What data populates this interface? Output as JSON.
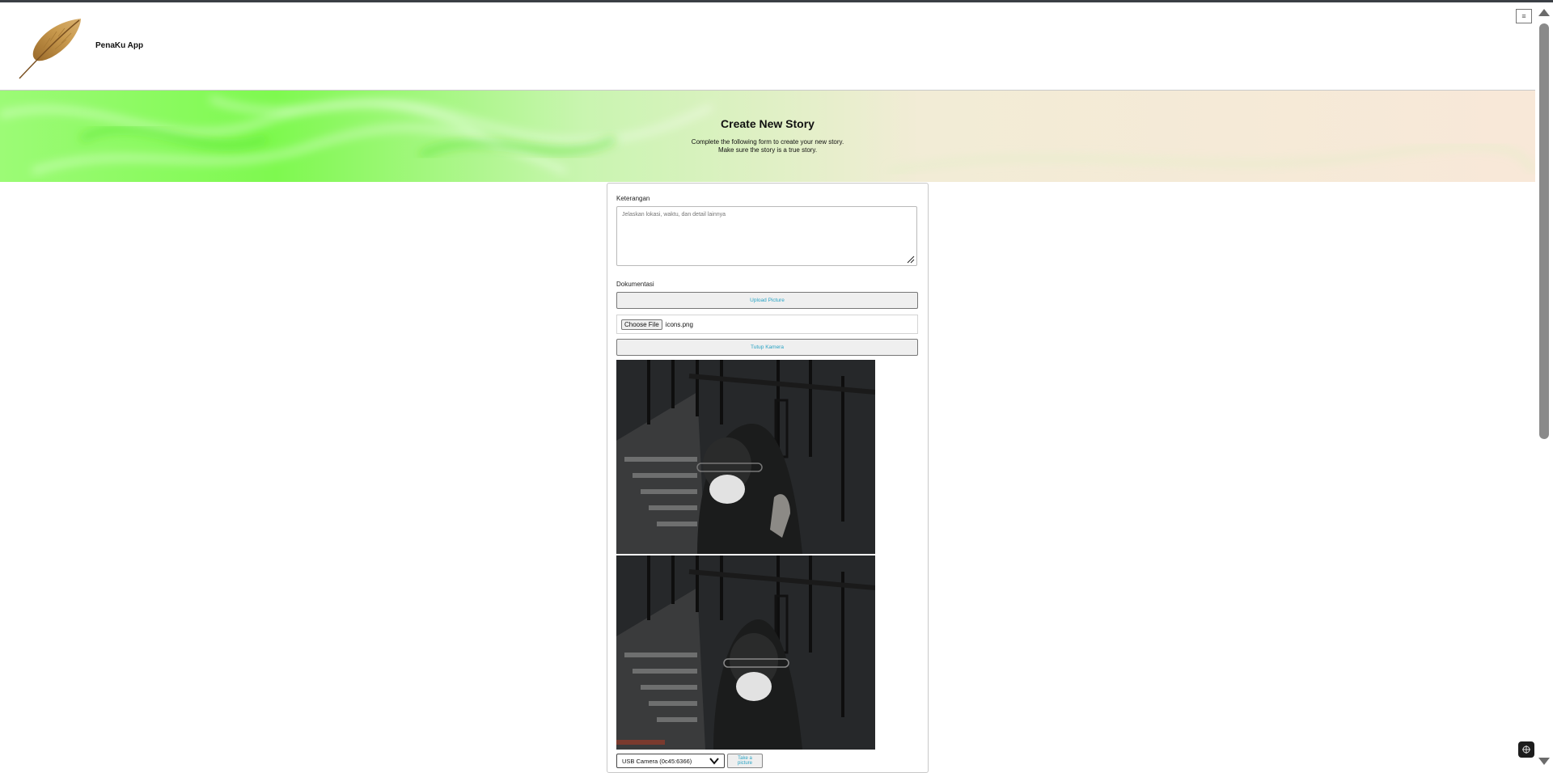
{
  "app": {
    "brand": "PenaKu App",
    "menu_icon": "hamburger-icon",
    "logo_icon": "feather-quill-icon"
  },
  "hero": {
    "title": "Create New Story",
    "subtitle_line1": "Complete the following form to create your new story.",
    "subtitle_line2": "Make sure the story is a true story.",
    "colors": {
      "green": "#7dfa4e",
      "cream": "#f7eadb"
    }
  },
  "form": {
    "description_label": "Keterangan",
    "description_placeholder": "Jelaskan lokasi, waktu, dan detail lainnya",
    "description_value": "",
    "documentation_label": "Dokumentasi",
    "upload_button": "Upload Picture",
    "file_button": "Choose File",
    "file_name": "icons.png",
    "camera_toggle_button": "Tutup Kamera",
    "camera_select_value": "USB Camera (0c45:6366)",
    "take_picture_button": "Take a picture",
    "accent_color": "#29a3c4"
  },
  "scrollbar": {
    "up_icon": "scroll-up-arrow-icon",
    "down_icon": "scroll-down-arrow-icon"
  }
}
